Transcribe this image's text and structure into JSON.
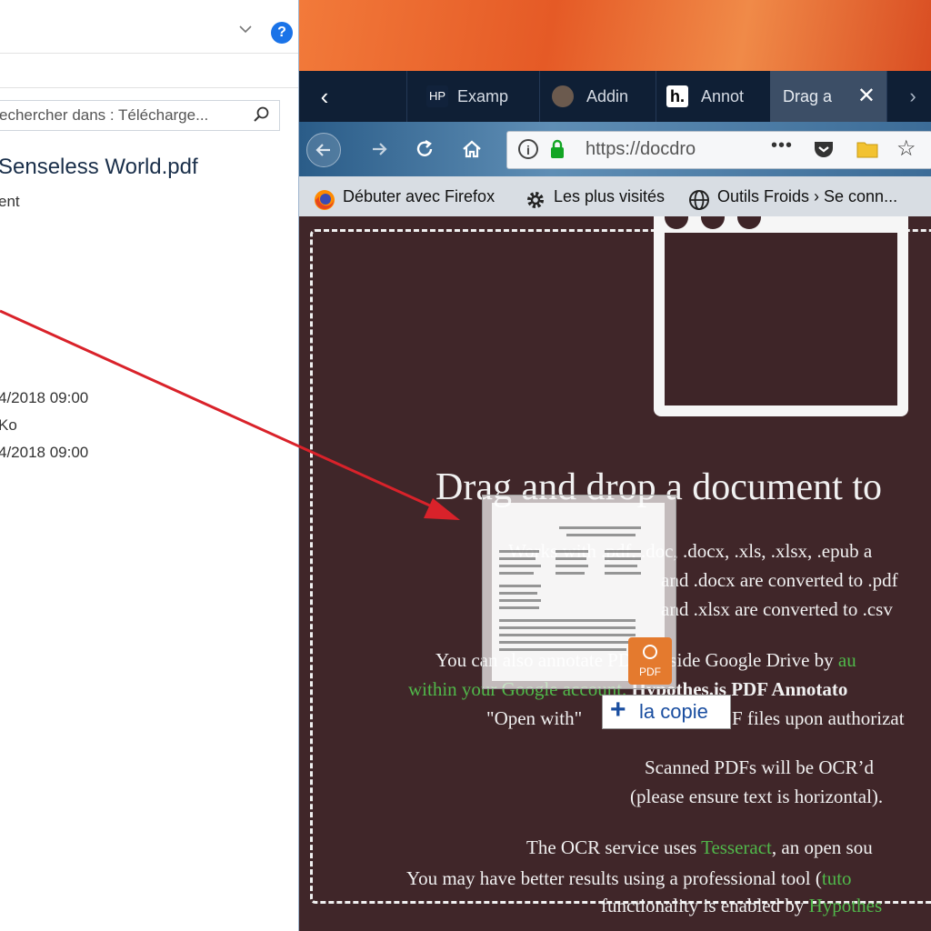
{
  "explorer": {
    "help_glyph": "?",
    "search_placeholder": "echercher dans : Télécharge...",
    "file_name": "Senseless World.pdf",
    "file_type": "ent",
    "meta": [
      "4/2018 09:00",
      "Ko",
      "4/2018 09:00"
    ]
  },
  "browser": {
    "tabs": [
      {
        "label": "Examp",
        "icon": "hp-icon"
      },
      {
        "label": "Addin",
        "icon": "avatar-icon"
      },
      {
        "label": "Annot",
        "icon": "h-icon"
      },
      {
        "label": "Drag a",
        "icon": "none",
        "active": true
      }
    ],
    "url": "https://docdro",
    "bookmarks": [
      {
        "label": "Débuter avec Firefox",
        "icon": "firefox-icon"
      },
      {
        "label": "Les plus visités",
        "icon": "gear-icon"
      },
      {
        "label": "Outils Froids › Se conn...",
        "icon": "globe-icon"
      }
    ]
  },
  "content": {
    "heading": "Drag and drop a document to",
    "works_line": "Works with .pdf, .doc, .docx, .xls, .xlsx, .epub a",
    "line2": "and .docx are converted to .pdf",
    "line3": "and .xlsx are converted to .csv",
    "annot_line_a": "You can also annotate PDFs inside Google Drive by ",
    "annot_link_a": "au",
    "annot_link_b": "within your Google account.",
    "annot_bold": " Hypothes.is PDF Annotato",
    "open_with": "\"Open with\"",
    "open_with_rest": "F files upon authorizat",
    "scanned_1": "Scanned PDFs will be OCR’d",
    "scanned_2": "(please ensure text is horizontal).",
    "ocr_a": "The OCR service uses ",
    "ocr_link": "Tesseract",
    "ocr_b": ", an open sou",
    "better_a": "You may have better results using a professional tool (",
    "better_link": "tuto",
    "func_a": "functionality is enabled by ",
    "func_link": "Hypothes",
    "pdf_label": "PDF",
    "copy_label": "la copie"
  },
  "colors": {
    "accent_link": "#50b84a",
    "arrow": "#d9222a",
    "content_bg": "#402629"
  }
}
